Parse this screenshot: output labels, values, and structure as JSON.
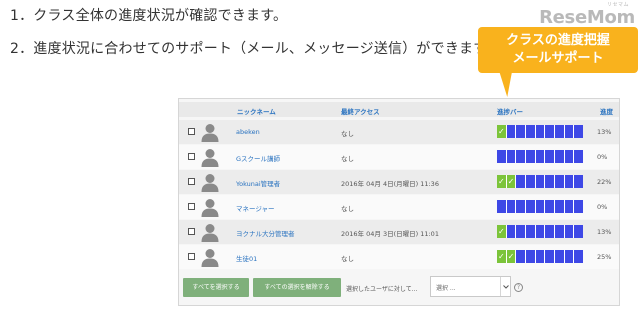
{
  "intro": {
    "line1": "1．クラス全体の進度状況が確認できます。",
    "line2": "2．進度状況に合わせてのサポート（メール、メッセージ送信）ができます。"
  },
  "logo": {
    "text": "ReseMom",
    "ruby": "リセマム"
  },
  "callout": {
    "line1": "クラスの進度把握",
    "line2": "メールサポート",
    "color": "#f9b21d"
  },
  "table": {
    "headers": {
      "nickname": "ニックネーム",
      "last_access": "最終アクセス",
      "progress_bar": "進捗バー",
      "progress": "進度"
    },
    "rows": [
      {
        "nickname": "abeken",
        "last_access": "なし",
        "done_segments": 1,
        "progress": "13%"
      },
      {
        "nickname": "Gスクール講師",
        "last_access": "なし",
        "done_segments": 0,
        "progress": "0%"
      },
      {
        "nickname": "Yokunai管理者",
        "last_access": "2016年 04月 4日(月曜日) 11:36",
        "done_segments": 2,
        "progress": "22%"
      },
      {
        "nickname": "マネージャー",
        "last_access": "なし",
        "done_segments": 0,
        "progress": "0%"
      },
      {
        "nickname": "ヨクナル大分管理者",
        "last_access": "2016年 04月 3日(日曜日) 11:01",
        "done_segments": 1,
        "progress": "13%"
      },
      {
        "nickname": "生徒01",
        "last_access": "なし",
        "done_segments": 2,
        "progress": "25%"
      }
    ],
    "total_segments": 9,
    "colors": {
      "done": "#7cc43a",
      "todo": "#3e48e6",
      "link": "#2a73c0"
    },
    "check_glyph": "✓"
  },
  "footer": {
    "select_all": "すべてを選択する",
    "deselect_all": "すべての選択を解除する",
    "action_label": "選択したユーザに対して...",
    "select_value": "選択 ...",
    "help": "?",
    "button_color": "#7fb07b"
  },
  "icons": {
    "avatar": "user-silhouette-icon",
    "dropdown": "chevron-down-icon",
    "help": "question-circle-icon"
  }
}
